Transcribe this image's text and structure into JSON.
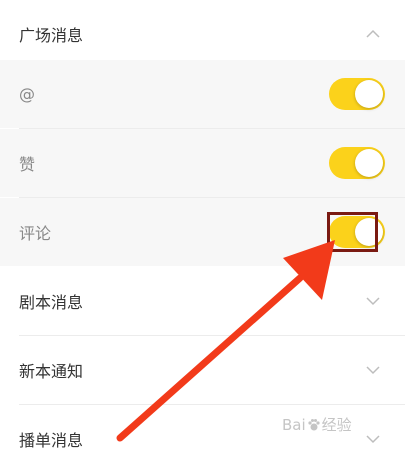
{
  "sections": {
    "plaza": {
      "title": "广场消息",
      "expanded": true
    },
    "mention": {
      "label": "@",
      "enabled": true
    },
    "like": {
      "label": "赞",
      "enabled": true
    },
    "comment": {
      "label": "评论",
      "enabled": true
    },
    "script": {
      "title": "剧本消息",
      "expanded": false
    },
    "new_notice": {
      "title": "新本通知",
      "expanded": false
    },
    "playlist": {
      "title": "播单消息",
      "expanded": false
    }
  },
  "colors": {
    "toggle_on": "#fbd21b",
    "sub_bg": "#f7f7f7",
    "annotation_arrow": "#f23a1a",
    "annotation_box": "#7a1a12"
  },
  "watermark": {
    "text_a": "Bai",
    "text_b": "经验",
    "paw_icon": "baidu-paw-icon"
  }
}
